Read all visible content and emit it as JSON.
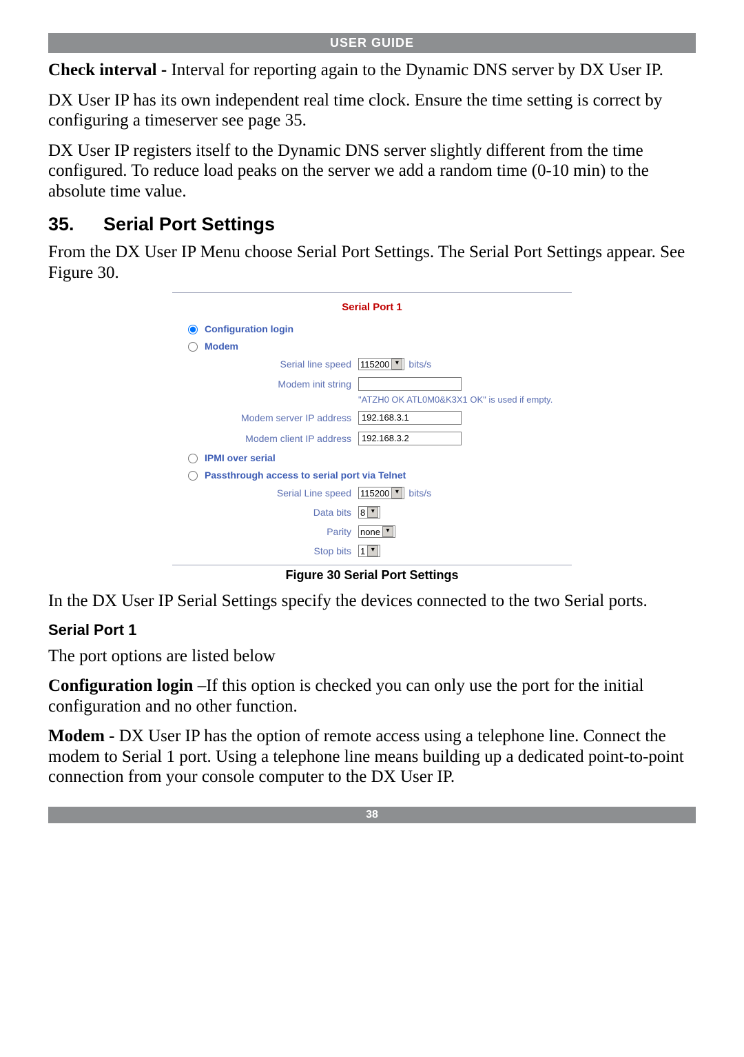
{
  "header": "USER GUIDE",
  "p1_bold": "Check interval -",
  "p1_rest": " Interval for reporting again to the Dynamic DNS server by DX User IP.",
  "p2": "DX User IP has its own independent real time clock. Ensure the time setting is correct by configuring a timeserver see page 35.",
  "p3": "DX User IP registers itself to the Dynamic DNS server slightly different from the time configured. To reduce load peaks on the server we add a random time (0-10 min) to the absolute time value.",
  "section_number": "35.",
  "section_title": "Serial Port Settings",
  "p4": "From the DX User IP Menu choose Serial Port Settings. The Serial Port Settings appear. See Figure 30.",
  "panel": {
    "title": "Serial Port 1",
    "opt_config": "Configuration login",
    "opt_modem": "Modem",
    "lbl_speed1": "Serial line speed",
    "val_speed1": "115200",
    "unit_speed": "bits/s",
    "lbl_init": "Modem init string",
    "val_init": "",
    "hint": "\"ATZH0 OK ATL0M0&K3X1 OK\" is used if empty.",
    "lbl_server": "Modem server IP address",
    "val_server": "192.168.3.1",
    "lbl_client": "Modem client IP address",
    "val_client": "192.168.3.2",
    "opt_ipmi": "IPMI over serial",
    "opt_pass": "Passthrough access to serial port via Telnet",
    "lbl_speed2": "Serial Line speed",
    "val_speed2": "115200",
    "lbl_data": "Data bits",
    "val_data": "8",
    "lbl_parity": "Parity",
    "val_parity": "none",
    "lbl_stop": "Stop bits",
    "val_stop": "1"
  },
  "figure_caption": "Figure 30 Serial Port Settings",
  "p5": "In the DX User IP Serial Settings specify the devices connected to the two Serial ports.",
  "sub_heading": "Serial Port 1",
  "p6": "The port options are listed below",
  "p7_bold": "Configuration login",
  "p7_rest": " –If this option is checked you can only use the port for the initial configuration and no other function.",
  "p8_bold": "Modem",
  "p8_rest": " - DX User IP has the option of remote access using a telephone line. Connect the modem to Serial 1 port. Using a telephone line means building up a dedicated point-to-point connection from your console computer to the DX User IP.",
  "page_number": "38"
}
